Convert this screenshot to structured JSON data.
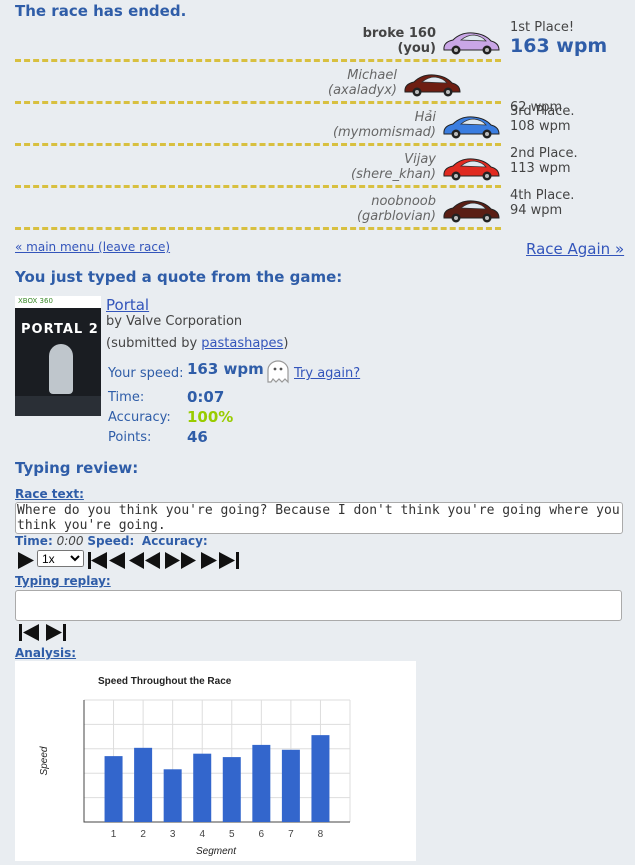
{
  "header": {
    "title": "The race has ended."
  },
  "racers": [
    {
      "name": "broke 160",
      "user": "(you)",
      "place": "1st Place!",
      "wpm": "163 wpm",
      "car_color": "#c9a6e6"
    },
    {
      "name": "Michael",
      "user": "(axaladyx)",
      "place": "",
      "wpm": "62 wpm",
      "car_color": "#6e1e12"
    },
    {
      "name": "Hải",
      "user": "(mymomismad)",
      "place": "3rd Place.",
      "wpm": "108 wpm",
      "car_color": "#3a7de0"
    },
    {
      "name": "Vijay",
      "user": "(shere_khan)",
      "place": "2nd Place.",
      "wpm": "113 wpm",
      "car_color": "#e02a20"
    },
    {
      "name": "noobnoob",
      "user": "(garblovian)",
      "place": "4th Place.",
      "wpm": "94 wpm",
      "car_color": "#5a1e14"
    }
  ],
  "nav": {
    "main_menu": "« main menu (leave race)",
    "race_again": "Race Again »"
  },
  "quote_section": {
    "heading": "You just typed a quote from the game:",
    "title": "Portal",
    "by": "by Valve Corporation",
    "submitted_prefix": "(submitted by ",
    "submitter": "pastashapes",
    "submitted_suffix": ")",
    "cover_logo": "PORTAL 2",
    "cover_badge": "XBOX 360"
  },
  "stats": {
    "speed_label": "Your speed:",
    "speed_value": "163 wpm",
    "try_again": "Try again?",
    "time_label": "Time:",
    "time_value": "0:07",
    "accuracy_label": "Accuracy:",
    "accuracy_value": "100%",
    "points_label": "Points:",
    "points_value": "46"
  },
  "review": {
    "heading": "Typing review:",
    "race_text_label": "Race text:",
    "race_text": "Where do you think you're going? Because I don't think you're going where you think you're going.",
    "time_label": "Time:",
    "time_value": "0:00",
    "speed_label": "Speed:",
    "accuracy_label": "Accuracy:",
    "speed_option": "1x",
    "replay_label": "Typing replay:",
    "analysis_label": "Analysis:"
  },
  "chart_data": {
    "type": "bar",
    "title": "Speed Throughout the Race",
    "xlabel": "Segment",
    "ylabel": "Speed",
    "categories": [
      "1",
      "2",
      "3",
      "4",
      "5",
      "6",
      "7",
      "8"
    ],
    "values": [
      135,
      152,
      108,
      140,
      133,
      158,
      148,
      178
    ],
    "ylim": [
      0,
      250
    ],
    "grid": true,
    "color": "#3366cc"
  }
}
